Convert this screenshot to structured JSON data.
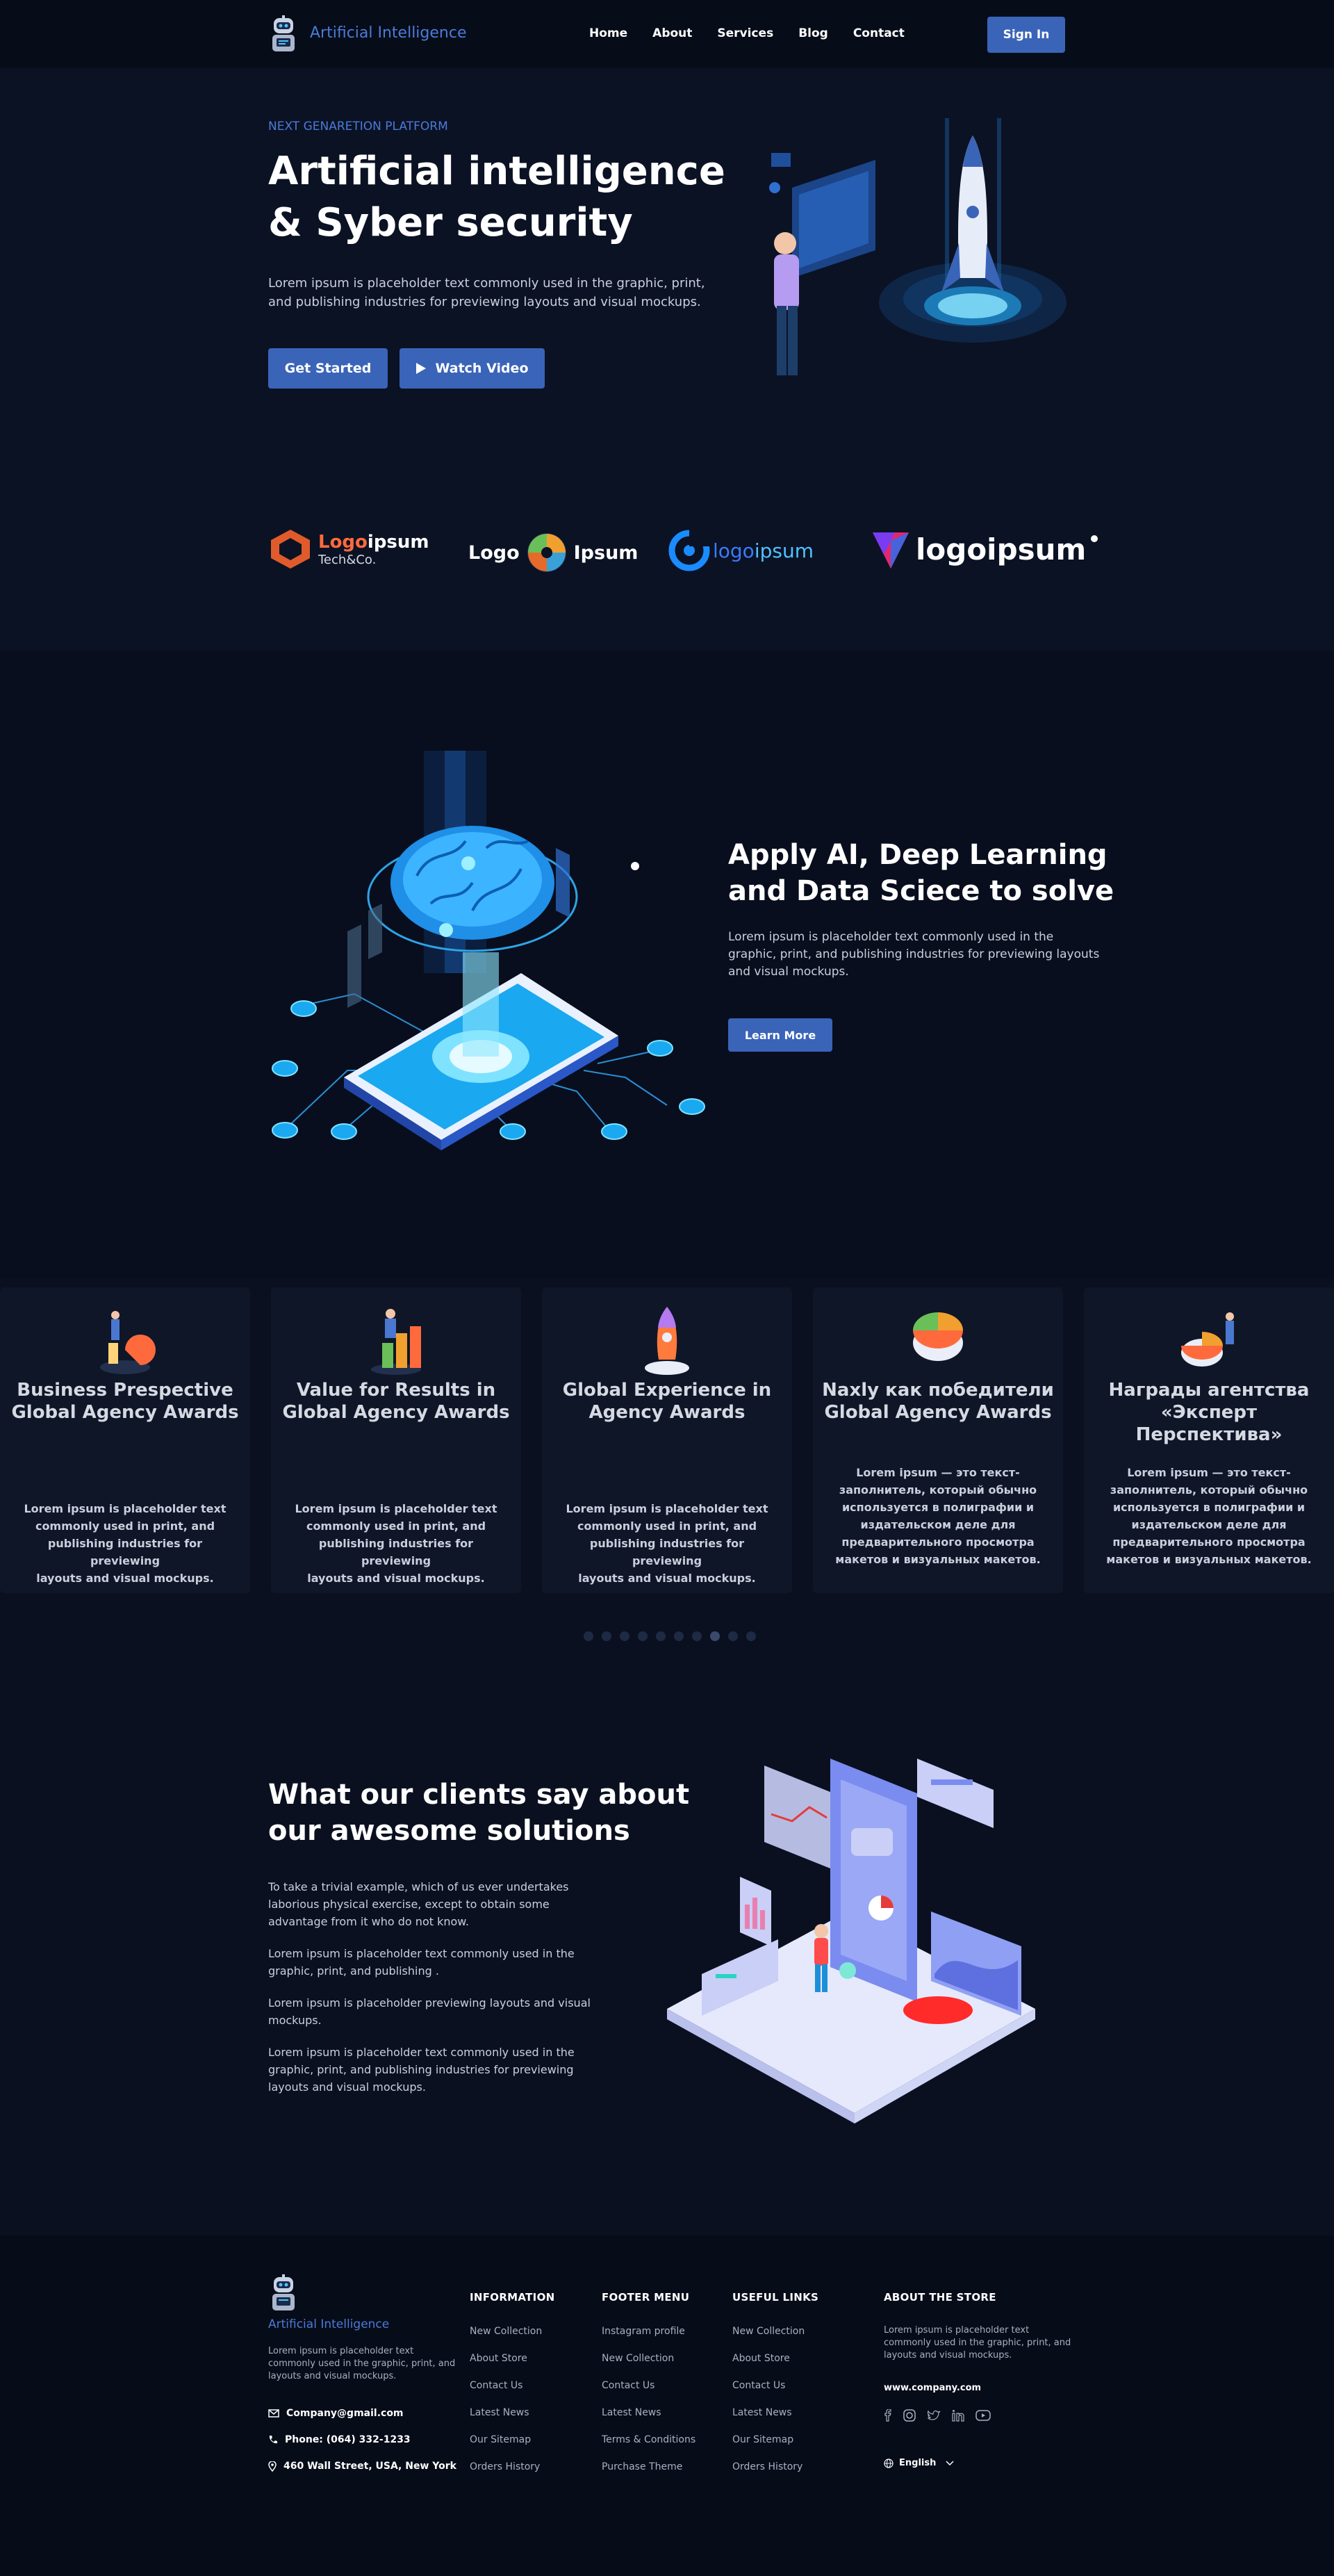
{
  "header": {
    "brand": "Artificial Intelligence",
    "nav": [
      "Home",
      "About",
      "Services",
      "Blog",
      "Contact"
    ],
    "signin": "Sign In"
  },
  "hero": {
    "eyebrow": "NEXT GENARETION PLATFORM",
    "title_line1": "Artificial intelligence",
    "title_line2": "& Syber security",
    "text_line1": "Lorem ipsum is placeholder text commonly used in the graphic, print,",
    "text_line2": "and publishing industries for previewing layouts and visual mockups.",
    "get_started": "Get Started",
    "watch_video": "Watch Video"
  },
  "logos": [
    {
      "a": "Logo",
      "b": "ipsum",
      "c": "Tech&Co."
    },
    {
      "a": "Logo",
      "b": "Ipsum"
    },
    {
      "a": "logo",
      "b": "ipsum"
    },
    {
      "a": "logoipsum"
    }
  ],
  "feature": {
    "title_line1": "Apply AI, Deep Learning",
    "title_line2": "and Data Sciece to solve",
    "text_line1": "Lorem ipsum is placeholder text commonly used in the",
    "text_line2": "graphic, print, and publishing industries for previewing layouts",
    "text_line3": "and visual mockups.",
    "button": "Learn More"
  },
  "cards": [
    {
      "title1": "Business Prespective",
      "title2": "Global Agency Awards",
      "title3": "",
      "text": [
        "Lorem ipsum is placeholder text",
        "commonly used in print, and",
        "publishing industries for previewing",
        "layouts and visual mockups."
      ]
    },
    {
      "title1": "Value for Results in",
      "title2": "Global Agency Awards",
      "title3": "",
      "text": [
        "Lorem ipsum is placeholder text",
        "commonly used in print, and",
        "publishing industries for previewing",
        "layouts and visual mockups."
      ]
    },
    {
      "title1": "Global Experience in",
      "title2": "Agency Awards",
      "title3": "",
      "text": [
        "Lorem ipsum is placeholder text",
        "commonly used in print, and",
        "publishing industries for previewing",
        "layouts and visual mockups."
      ]
    },
    {
      "title1": "Naxly как победители",
      "title2": "Global Agency Awards",
      "title3": "",
      "text": [
        "Lorem ipsum — это текст-",
        "заполнитель, который обычно",
        "используется в полиграфии и",
        "издательском деле для",
        "предварительного просмотра",
        "макетов и визуальных макетов."
      ]
    },
    {
      "title1": "Награды агентства",
      "title2": "«Эксперт",
      "title3": "Перспектива»",
      "text": [
        "Lorem ipsum — это текст-",
        "заполнитель, который обычно",
        "используется в полиграфии и",
        "издательском деле для",
        "предварительного просмотра",
        "макетов и визуальных макетов."
      ]
    }
  ],
  "carousel": {
    "total": 10,
    "active": 7
  },
  "testimonials": {
    "title_line1": "What our clients say about",
    "title_line2": "our awesome solutions",
    "p1": [
      "To take a trivial example, which of us ever undertakes",
      "laborious physical exercise, except to obtain some",
      "advantage from it who do not know."
    ],
    "p2": [
      "Lorem ipsum is placeholder text commonly used in the",
      "graphic, print, and publishing ."
    ],
    "p3": [
      "Lorem ipsum is placeholder previewing layouts and visual",
      "mockups."
    ],
    "p4": [
      "Lorem ipsum is placeholder text commonly used in the",
      "graphic, print, and publishing industries for previewing",
      "layouts and visual mockups."
    ]
  },
  "footer": {
    "brand": "Artificial Intelligence",
    "about": [
      "Lorem ipsum is placeholder text",
      "commonly used in the graphic, print, and",
      "layouts and visual mockups."
    ],
    "email": "Company@gmail.com",
    "phone": "Phone: (064) 332-1233",
    "address": "460 Wall Street, USA, New York",
    "information": {
      "title": "INFORMATION",
      "links": [
        "New Collection",
        "About Store",
        "Contact Us",
        "Latest News",
        "Our Sitemap",
        "Orders History"
      ]
    },
    "footer_menu": {
      "title": "FOOTER MENU",
      "links": [
        "Instagram profile",
        "New Collection",
        "Contact Us",
        "Latest News",
        "Terms & Conditions",
        "Purchase Theme"
      ]
    },
    "useful_links": {
      "title": "USEFUL LINKS",
      "links": [
        "New Collection",
        "About Store",
        "Contact Us",
        "Latest News",
        "Our Sitemap",
        "Orders History"
      ]
    },
    "about_store": {
      "title": "ABOUT THE STORE",
      "text": [
        "Lorem ipsum is placeholder text",
        "commonly used in the graphic, print, and",
        "layouts and visual mockups."
      ],
      "website": "www.company.com"
    },
    "socials": [
      "facebook-icon",
      "instagram-icon",
      "twitter-icon",
      "linkedin-icon",
      "youtube-icon"
    ],
    "language": "English"
  }
}
